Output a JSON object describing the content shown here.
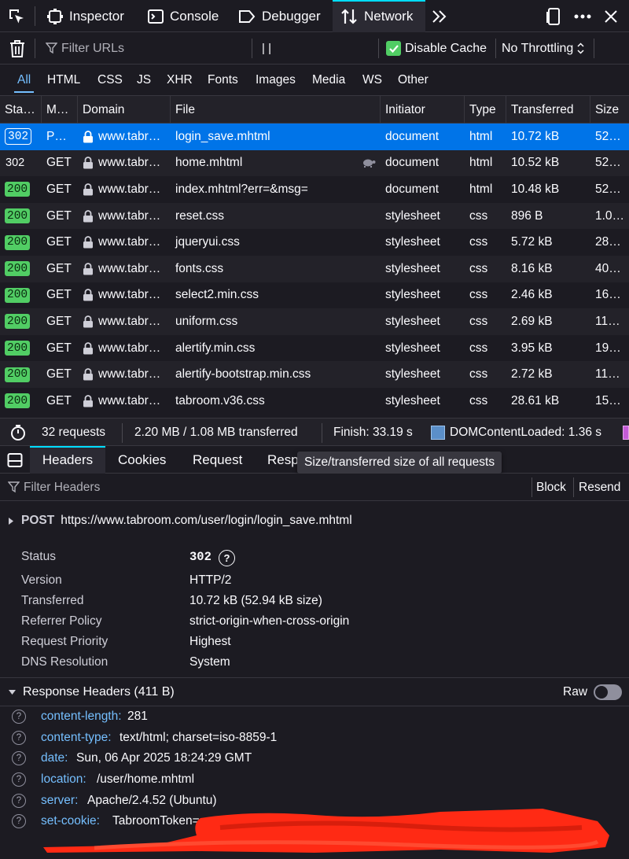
{
  "topbar": {
    "tabs": [
      {
        "label": "Inspector",
        "icon": "inspector-icon"
      },
      {
        "label": "Console",
        "icon": "console-icon"
      },
      {
        "label": "Debugger",
        "icon": "debugger-icon"
      },
      {
        "label": "Network",
        "icon": "network-icon",
        "selected": true
      }
    ]
  },
  "toolbar": {
    "filter_placeholder": "Filter URLs",
    "pause_label": "| |",
    "disable_cache_label": "Disable Cache",
    "disable_cache_checked": true,
    "throttling_value": "No Throttling"
  },
  "filter_types": [
    "All",
    "HTML",
    "CSS",
    "JS",
    "XHR",
    "Fonts",
    "Images",
    "Media",
    "WS",
    "Other"
  ],
  "table": {
    "columns": [
      "Sta…",
      "M…",
      "Domain",
      "File",
      "Initiator",
      "Type",
      "Transferred",
      "Size"
    ],
    "rows": [
      {
        "status": "302",
        "method": "P…",
        "domain": "www.tabr…",
        "file": "login_save.mhtml",
        "initiator": "document",
        "type": "html",
        "transferred": "10.72 kB",
        "size": "52…",
        "selected": true
      },
      {
        "status": "302",
        "method": "GET",
        "domain": "www.tabr…",
        "file": "home.mhtml",
        "initiator": "document",
        "type": "html",
        "transferred": "10.52 kB",
        "size": "52…",
        "slow": true
      },
      {
        "status": "200",
        "method": "GET",
        "domain": "www.tabr…",
        "file": "index.mhtml?err=&msg=",
        "initiator": "document",
        "type": "html",
        "transferred": "10.48 kB",
        "size": "52…"
      },
      {
        "status": "200",
        "method": "GET",
        "domain": "www.tabr…",
        "file": "reset.css",
        "initiator": "stylesheet",
        "type": "css",
        "transferred": "896 B",
        "size": "1.0…"
      },
      {
        "status": "200",
        "method": "GET",
        "domain": "www.tabr…",
        "file": "jqueryui.css",
        "initiator": "stylesheet",
        "type": "css",
        "transferred": "5.72 kB",
        "size": "28…"
      },
      {
        "status": "200",
        "method": "GET",
        "domain": "www.tabr…",
        "file": "fonts.css",
        "initiator": "stylesheet",
        "type": "css",
        "transferred": "8.16 kB",
        "size": "40…"
      },
      {
        "status": "200",
        "method": "GET",
        "domain": "www.tabr…",
        "file": "select2.min.css",
        "initiator": "stylesheet",
        "type": "css",
        "transferred": "2.46 kB",
        "size": "16…"
      },
      {
        "status": "200",
        "method": "GET",
        "domain": "www.tabr…",
        "file": "uniform.css",
        "initiator": "stylesheet",
        "type": "css",
        "transferred": "2.69 kB",
        "size": "11…"
      },
      {
        "status": "200",
        "method": "GET",
        "domain": "www.tabr…",
        "file": "alertify.min.css",
        "initiator": "stylesheet",
        "type": "css",
        "transferred": "3.95 kB",
        "size": "19…"
      },
      {
        "status": "200",
        "method": "GET",
        "domain": "www.tabr…",
        "file": "alertify-bootstrap.min.css",
        "initiator": "stylesheet",
        "type": "css",
        "transferred": "2.72 kB",
        "size": "11…"
      },
      {
        "status": "200",
        "method": "GET",
        "domain": "www.tabr…",
        "file": "tabroom.v36.css",
        "initiator": "stylesheet",
        "type": "css",
        "transferred": "28.61 kB",
        "size": "15…"
      }
    ]
  },
  "statusbar": {
    "requests": "32 requests",
    "size": "2.20 MB / 1.08 MB transferred",
    "finish": "Finish: 33.19 s",
    "dcl": "DOMContentLoaded: 1.36 s"
  },
  "detail_tabs": [
    "Headers",
    "Cookies",
    "Request",
    "Resp"
  ],
  "tooltip": "Size/transferred size of all requests",
  "headers_panel": {
    "filter_placeholder": "Filter Headers",
    "block_label": "Block",
    "resend_label": "Resend",
    "method": "POST",
    "url": "https://www.tabroom.com/user/login/login_save.mhtml",
    "summary": [
      {
        "key": "Status",
        "value": "302"
      },
      {
        "key": "Version",
        "value": "HTTP/2"
      },
      {
        "key": "Transferred",
        "value": "10.72 kB (52.94 kB size)"
      },
      {
        "key": "Referrer Policy",
        "value": "strict-origin-when-cross-origin"
      },
      {
        "key": "Request Priority",
        "value": "Highest"
      },
      {
        "key": "DNS Resolution",
        "value": "System"
      }
    ],
    "response_title": "Response Headers (411 B)",
    "raw_label": "Raw",
    "raw_on": false,
    "response_headers": [
      {
        "key": "content-length:",
        "value": "281"
      },
      {
        "key": "content-type:",
        "value": "text/html; charset=iso-8859-1"
      },
      {
        "key": "date:",
        "value": "Sun, 06 Apr 2025 18:24:29 GMT"
      },
      {
        "key": "location:",
        "value": "/user/home.mhtml"
      },
      {
        "key": "server:",
        "value": "Apache/2.4.52 (Ubuntu)"
      },
      {
        "key": "set-cookie:",
        "value": "TabroomToken="
      }
    ]
  },
  "colors": {
    "accent": "#0df",
    "selected_row": "#0074e8",
    "status_200": "#51cd64",
    "header_key": "#75bfff",
    "redaction": "#ff2a14"
  }
}
